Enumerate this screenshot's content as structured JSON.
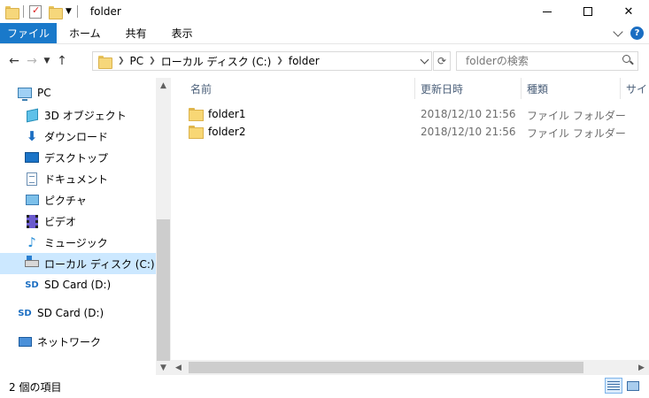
{
  "window": {
    "title": "folder",
    "controls": {
      "minimize": "minimize",
      "maximize": "maximize",
      "close": "✕"
    }
  },
  "ribbon": {
    "tabs": [
      {
        "label": "ファイル",
        "active": true
      },
      {
        "label": "ホーム"
      },
      {
        "label": "共有"
      },
      {
        "label": "表示"
      }
    ],
    "help": "?"
  },
  "address_bar": {
    "segments": [
      "PC",
      "ローカル ディスク (C:)",
      "folder"
    ],
    "refresh_glyph": "⟳"
  },
  "search": {
    "placeholder": "folderの検索",
    "value": ""
  },
  "sidebar": {
    "items": [
      {
        "label": "PC",
        "icon": "pc-icon",
        "indent": 0
      },
      {
        "label": "3D オブジェクト",
        "icon": "3d-objects-icon",
        "indent": 1
      },
      {
        "label": "ダウンロード",
        "icon": "download-icon",
        "indent": 1
      },
      {
        "label": "デスクトップ",
        "icon": "desktop-icon",
        "indent": 1
      },
      {
        "label": "ドキュメント",
        "icon": "documents-icon",
        "indent": 1
      },
      {
        "label": "ピクチャ",
        "icon": "pictures-icon",
        "indent": 1
      },
      {
        "label": "ビデオ",
        "icon": "videos-icon",
        "indent": 1
      },
      {
        "label": "ミュージック",
        "icon": "music-icon",
        "indent": 1
      },
      {
        "label": "ローカル ディスク (C:)",
        "icon": "local-disk-icon",
        "indent": 1,
        "selected": true
      },
      {
        "label": "SD Card (D:)",
        "icon": "sd-card-icon",
        "indent": 1
      },
      {
        "label": "SD Card (D:)",
        "icon": "sd-card-icon",
        "indent": 0
      },
      {
        "label": "ネットワーク",
        "icon": "network-icon",
        "indent": 0
      }
    ]
  },
  "file_list": {
    "columns": [
      "名前",
      "更新日時",
      "種類",
      "サイ"
    ],
    "rows": [
      {
        "name": "folder1",
        "modified": "2018/12/10 21:56",
        "type": "ファイル フォルダー"
      },
      {
        "name": "folder2",
        "modified": "2018/12/10 21:56",
        "type": "ファイル フォルダー"
      }
    ]
  },
  "status": {
    "item_count": "2 個の項目"
  },
  "colors": {
    "accent": "#1979ca",
    "selection": "#cce8ff"
  }
}
